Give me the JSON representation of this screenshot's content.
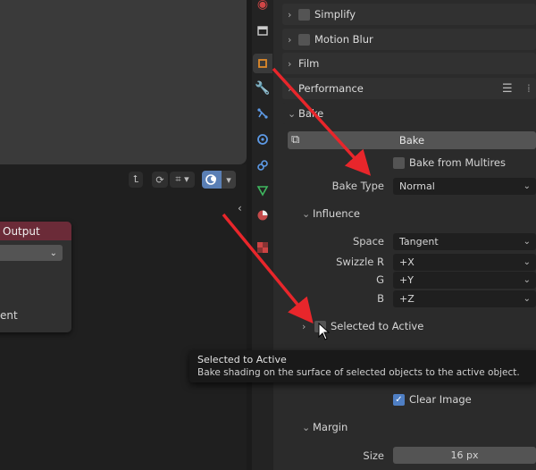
{
  "node_output": {
    "title": "Output",
    "label_partial": "ent",
    "dropdown_arrow": "chevron-down-icon"
  },
  "panels": {
    "simplify": "Simplify",
    "motion_blur": "Motion Blur",
    "film": "Film",
    "performance": "Performance",
    "bake": "Bake"
  },
  "bake": {
    "button_label": "Bake",
    "bake_from_multires": "Bake from Multires",
    "bake_type_label": "Bake Type",
    "bake_type_value": "Normal",
    "influence": "Influence",
    "space_label": "Space",
    "space_value": "Tangent",
    "swizzle_r_label": "Swizzle R",
    "swizzle_r_value": "+X",
    "g_label": "G",
    "g_value": "+Y",
    "b_label": "B",
    "b_value": "+Z",
    "selected_to_active": "Selected to Active",
    "clear_image": "Clear Image",
    "margin": "Margin",
    "size_label": "Size",
    "size_value": "16 px"
  },
  "tooltip": {
    "title": "Selected to Active",
    "description": "Bake shading on the surface of selected objects to the active object."
  },
  "colors": {
    "accent_blue": "#4f7fc4",
    "arrow_red": "#e8262b",
    "node_header": "#6b2b38"
  }
}
